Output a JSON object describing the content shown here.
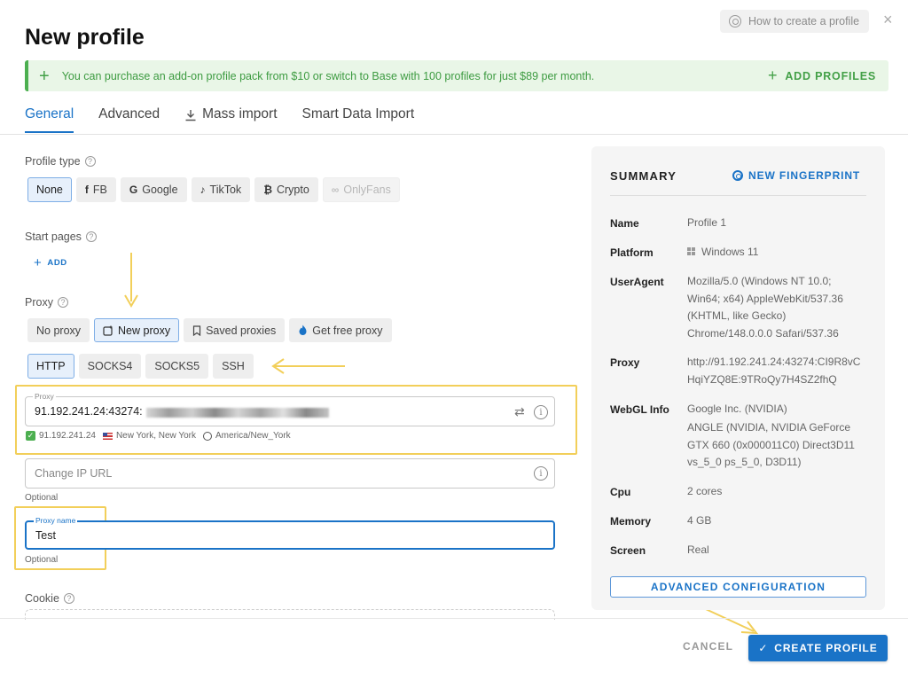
{
  "header": {
    "help_label": "How to create a profile",
    "close_glyph": "×",
    "title": "New profile"
  },
  "banner": {
    "plus_glyph": "+",
    "text": "You can purchase an add-on profile pack from $10 or switch to Base with 100 profiles for just $89 per month.",
    "action_label": "ADD PROFILES",
    "accent_color": "#4caf50"
  },
  "tabs": [
    {
      "label": "General",
      "active": true
    },
    {
      "label": "Advanced",
      "active": false
    },
    {
      "label": "Mass import",
      "active": false,
      "icon": "download-icon"
    },
    {
      "label": "Smart Data Import",
      "active": false
    }
  ],
  "profile_type": {
    "label": "Profile type",
    "options": [
      {
        "label": "None",
        "icon": "",
        "selected": true
      },
      {
        "label": "FB",
        "icon": "f"
      },
      {
        "label": "Google",
        "icon": "G"
      },
      {
        "label": "TikTok",
        "icon": "♪"
      },
      {
        "label": "Crypto",
        "icon": "₿"
      },
      {
        "label": "OnlyFans",
        "icon": "∞",
        "disabled": true
      }
    ]
  },
  "start_pages": {
    "label": "Start pages",
    "add_label": "ADD"
  },
  "proxy": {
    "label": "Proxy",
    "modes": [
      {
        "label": "No proxy"
      },
      {
        "label": "New proxy",
        "selected": true,
        "icon": "new-proxy-icon"
      },
      {
        "label": "Saved proxies",
        "icon": "bookmark-icon"
      },
      {
        "label": "Get free proxy",
        "icon": "flame-icon"
      }
    ],
    "protocols": [
      {
        "label": "HTTP",
        "selected": true
      },
      {
        "label": "SOCKS4"
      },
      {
        "label": "SOCKS5"
      },
      {
        "label": "SSH"
      }
    ],
    "field_label": "Proxy",
    "field_value": "91.192.241.24:43274:",
    "ip": "91.192.241.24",
    "location": "New York, New York",
    "timezone": "America/New_York",
    "change_ip_placeholder": "Change IP URL",
    "change_ip_helper": "Optional",
    "name_label": "Proxy name",
    "name_value": "Test",
    "name_helper": "Optional"
  },
  "cookie": {
    "label": "Cookie"
  },
  "summary": {
    "title": "SUMMARY",
    "new_fingerprint_label": "NEW FINGERPRINT",
    "rows": [
      {
        "key": "Name",
        "value": "Profile 1"
      },
      {
        "key": "Platform",
        "value": "Windows 11"
      },
      {
        "key": "UserAgent",
        "value": "Mozilla/5.0 (Windows NT 10.0; Win64; x64) AppleWebKit/537.36 (KHTML, like Gecko) Chrome/148.0.0.0 Safari/537.36"
      },
      {
        "key": "Proxy",
        "value": "http://91.192.241.24:43274:CI9R8vCHqiYZQ8E:9TRoQy7H4SZ2fhQ"
      },
      {
        "key": "WebGL Info",
        "value": "Google Inc. (NVIDIA)"
      },
      {
        "key": "",
        "value": "ANGLE (NVIDIA, NVIDIA GeForce GTX 660 (0x000011C0) Direct3D11 vs_5_0 ps_5_0, D3D11)"
      },
      {
        "key": "Cpu",
        "value": "2 cores"
      },
      {
        "key": "Memory",
        "value": "4 GB"
      },
      {
        "key": "Screen",
        "value": "Real"
      }
    ],
    "advanced_button": "ADVANCED CONFIGURATION"
  },
  "footer": {
    "cancel_label": "CANCEL",
    "create_label": "CREATE PROFILE",
    "create_icon": "✓",
    "primary_color": "#1a73c7"
  },
  "annotation_color": "#f2cf5a"
}
